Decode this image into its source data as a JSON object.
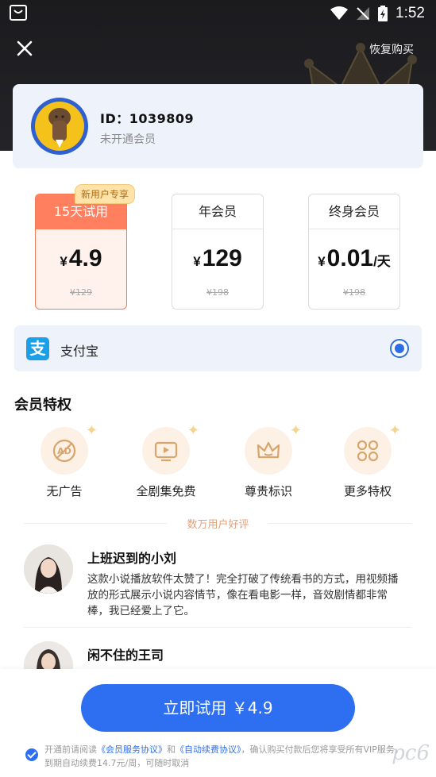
{
  "status_bar": {
    "time": "1:52"
  },
  "header": {
    "restore_label": "恢复购买"
  },
  "profile": {
    "id_text": "ID：1039809",
    "vip_status": "未开通会员"
  },
  "plans": [
    {
      "title": "15天试用",
      "currency": "¥",
      "price": "4.9",
      "unit": "",
      "original": "¥129",
      "badge": "新用户专享",
      "selected": true
    },
    {
      "title": "年会员",
      "currency": "¥",
      "price": "129",
      "unit": "",
      "original": "¥198",
      "selected": false
    },
    {
      "title": "终身会员",
      "currency": "¥",
      "price": "0.01",
      "unit": "/天",
      "original": "¥198",
      "selected": false
    }
  ],
  "payment": {
    "logo_char": "支",
    "label": "支付宝",
    "selected": true
  },
  "privileges": {
    "title": "会员特权",
    "items": [
      {
        "label": "无广告",
        "icon": "no-ad-icon"
      },
      {
        "label": "全剧集免费",
        "icon": "tv-icon"
      },
      {
        "label": "尊贵标识",
        "icon": "crown-icon"
      },
      {
        "label": "更多特权",
        "icon": "grid-icon"
      }
    ]
  },
  "reviews": {
    "title": "数万用户好评",
    "items": [
      {
        "name": "上班迟到的小刘",
        "text": "这款小说播放软件太赞了！完全打破了传统看书的方式，用视频播放的形式展示小说内容情节，像在看电影一样，音效剧情都非常棒，我已经爱上了它。"
      },
      {
        "name": "闲不住的王司",
        "text": ""
      }
    ]
  },
  "cta": {
    "label": "立即试用 ￥4.9"
  },
  "agreement": {
    "prefix": "开通前请阅读",
    "link1": "《会员服务协议》",
    "and": "和",
    "link2": "《自动续费协议》",
    "suffix": "，确认购买付款后您将享受所有VIP服务，到期自动续费14.7元/周，可随时取消"
  },
  "watermark": "pc6"
}
